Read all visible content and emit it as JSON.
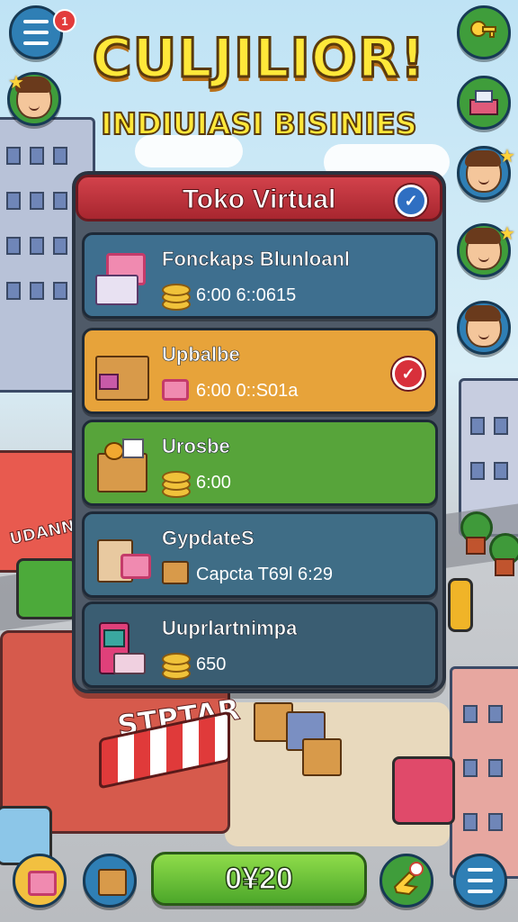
{
  "header": {
    "title": "CULJILIOR!",
    "subtitle": "INDIUIASI BISINIES",
    "menu_badge": "1"
  },
  "panel": {
    "title": "Toko Virtual",
    "items": [
      {
        "name": "Fonckaps Blunloanl",
        "value": "6:00  6::0615",
        "color": "#3e6f8f",
        "selected": false
      },
      {
        "name": "Upbalbe",
        "value": "6:00  0::S01a",
        "color": "#e7a33a",
        "selected": true
      },
      {
        "name": "Urosbe",
        "value": "6:00",
        "color": "#57a43a",
        "selected": false
      },
      {
        "name": "GypdatеS",
        "value": "Capcta  T69l  6:29",
        "color": "#3f6d86",
        "selected": false
      },
      {
        "name": "Uuprlartnimpa",
        "value": "650",
        "color": "#3a5d72",
        "selected": false
      }
    ]
  },
  "scene": {
    "sign_left": "UDANNT",
    "sign_shop": "STPTAR"
  },
  "bottom_bar": {
    "counter": "0¥20"
  },
  "icons": {
    "menu": "hamburger-icon",
    "key": "key-icon",
    "warehouse": "warehouse-icon",
    "cart": "shopping-cart-icon",
    "box": "box-icon",
    "hand": "pointing-hand-icon",
    "check": "checkmark-icon"
  }
}
